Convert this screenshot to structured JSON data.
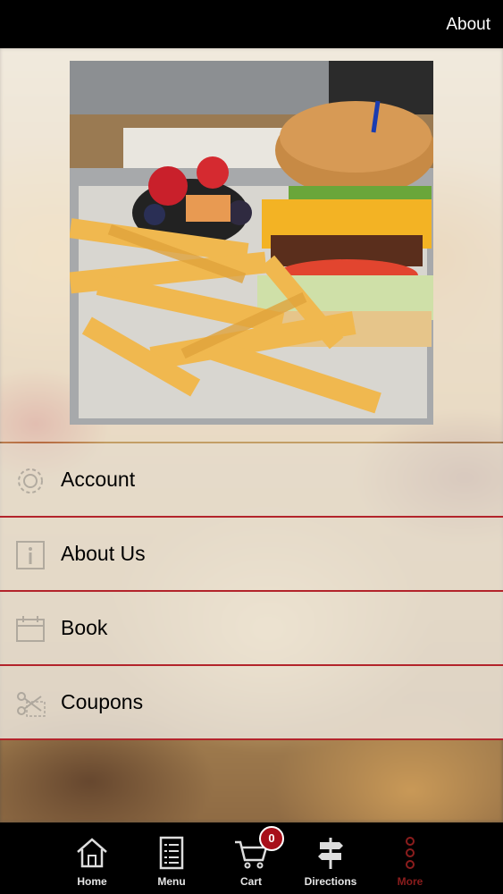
{
  "header": {
    "title": "About"
  },
  "menu": {
    "items": [
      {
        "label": "Account",
        "icon": "gear-icon"
      },
      {
        "label": "About Us",
        "icon": "info-icon"
      },
      {
        "label": "Book",
        "icon": "calendar-icon"
      },
      {
        "label": "Coupons",
        "icon": "scissors-icon"
      }
    ]
  },
  "tabbar": {
    "tabs": [
      {
        "label": "Home",
        "icon": "home-icon"
      },
      {
        "label": "Menu",
        "icon": "menu-list-icon"
      },
      {
        "label": "Cart",
        "icon": "cart-icon",
        "badge": "0"
      },
      {
        "label": "Directions",
        "icon": "signpost-icon"
      },
      {
        "label": "More",
        "icon": "more-icon",
        "active": true
      }
    ]
  },
  "colors": {
    "accent": "#b3242b",
    "badge": "#a8101a",
    "active_tab": "#8b1d1d"
  }
}
